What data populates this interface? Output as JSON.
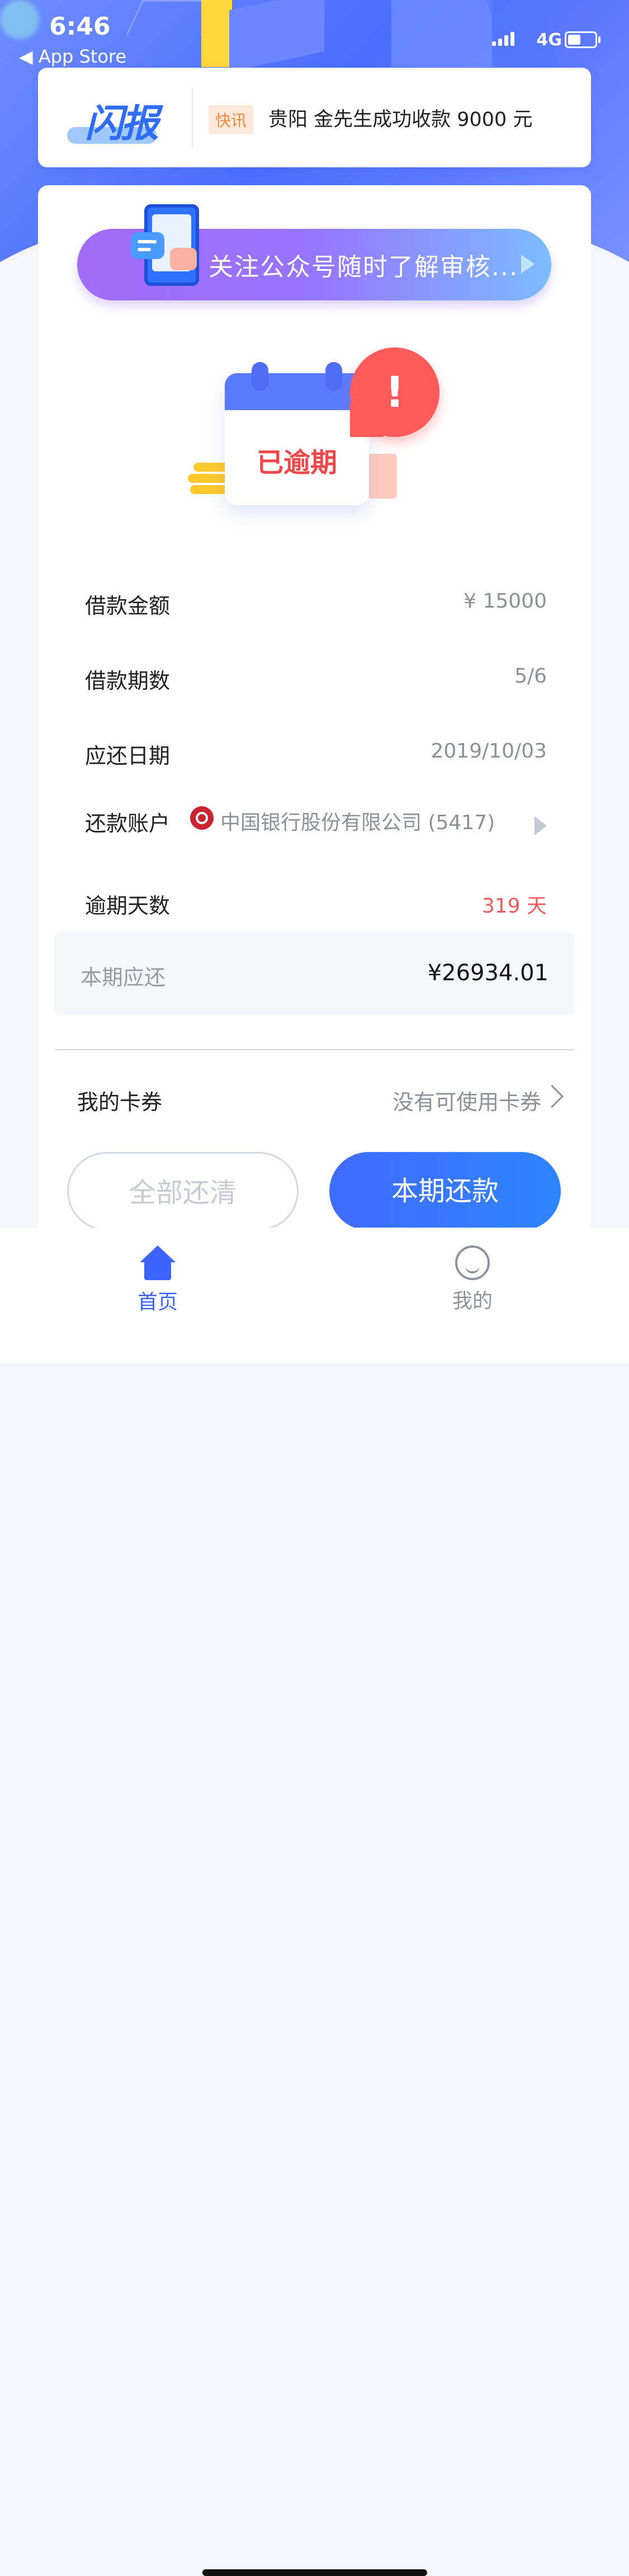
{
  "status_bar": {
    "time": "6:46",
    "back_app": "◀ App Store",
    "network": "4G"
  },
  "news": {
    "logo_text": "闪报",
    "tag": "快讯",
    "text": "贵阳 金先生成功收款 9000 元"
  },
  "banner": {
    "text": "关注公众号随时了解审核..."
  },
  "status_illustration": {
    "text": "已逾期",
    "alert_mark": "!"
  },
  "loan_details": [
    {
      "label": "借款金额",
      "value": "¥ 15000"
    },
    {
      "label": "借款期数",
      "value": "5/6"
    },
    {
      "label": "应还日期",
      "value": "2019/10/03"
    }
  ],
  "repayment_account": {
    "label": "还款账户",
    "bank": "中国银行股份有限公司 (5417)"
  },
  "overdue": {
    "label": "逾期天数",
    "value": "319 天",
    "color": "#f05a5a"
  },
  "current_due": {
    "label": "本期应还",
    "value": "¥26934.01"
  },
  "coupon": {
    "label": "我的卡券",
    "value": "没有可使用卡券"
  },
  "buttons": {
    "repay_all": "全部还清",
    "repay_current": "本期还款"
  },
  "tabbar": {
    "home": "首页",
    "me": "我的",
    "active_color": "#3d63ff"
  }
}
